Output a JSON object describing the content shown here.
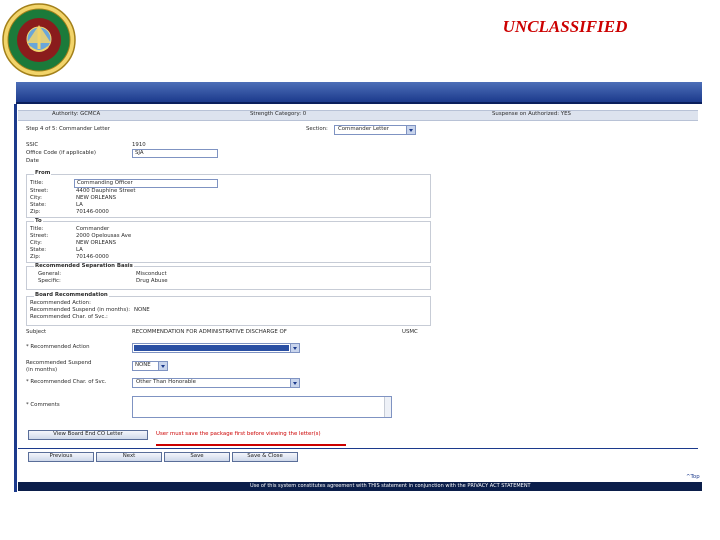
{
  "header": {
    "classification": "UNCLASSIFIED"
  },
  "seal": {
    "top_text": "U.S. MARINE CORPS",
    "bottom_text": "RESERVE"
  },
  "info_bar": {
    "authority": "Authority: GCMCA",
    "strength": "Strength Category: 0",
    "suspense": "Suspense on Authorized: YES"
  },
  "step": {
    "text": "Step 4 of 5: Commander Letter",
    "section_label": "Section:",
    "section_value": "Commander Letter"
  },
  "letter": {
    "ssic_label": "SSIC",
    "ssic_value": "1910",
    "office_label": "Office Code (if applicable)",
    "office_value": "SJA",
    "date_label": "Date"
  },
  "from": {
    "legend": "From",
    "title_label": "Title:",
    "title_value": "Commanding Officer",
    "street_label": "Street:",
    "street_value": "4400 Dauphine Street",
    "city_label": "City:",
    "city_value": "NEW ORLEANS",
    "state_label": "State:",
    "state_value": "LA",
    "zip_label": "Zip:",
    "zip_value": "70146-0000"
  },
  "to": {
    "legend": "To",
    "title_label": "Title:",
    "title_value": "Commander",
    "street_label": "Street:",
    "street_value": "2000 Opelousas Ave",
    "city_label": "City:",
    "city_value": "NEW ORLEANS",
    "state_label": "State:",
    "state_value": "LA",
    "zip_label": "Zip:",
    "zip_value": "70146-0000"
  },
  "separation": {
    "legend": "Recommended Separation Basis",
    "general_label": "General:",
    "general_value": "Misconduct",
    "specific_label": "Specific:",
    "specific_value": "Drug Abuse"
  },
  "board": {
    "legend": "Board Recommendation",
    "action_label": "Recommended Action:",
    "suspend_label": "Recommended Suspend (in months):",
    "suspend_value": "NONE",
    "char_label": "Recommended Char. of Svc.:"
  },
  "form": {
    "subject_label": "Subject",
    "subject_value": "RECOMMENDATION FOR ADMINISTRATIVE DISCHARGE OF",
    "subject_suffix": "USMC",
    "action_label": "* Recommended Action",
    "suspend_label": "Recommended Suspend",
    "suspend_sub": "(in months)",
    "suspend_value": "NONE",
    "char_label": "* Recommended Char. of Svc.",
    "char_value": "Other Than Honorable",
    "comments_label": "* Comments"
  },
  "actions": {
    "view_letter_button": "View Board End CO Letter",
    "warning": "User must save the package first before viewing the letter(s)",
    "previous": "Previous",
    "next": "Next",
    "save": "Save",
    "save_close": "Save & Close",
    "top_link": "^Top"
  },
  "footer": {
    "privacy": "Use of this system constitutes agreement with THIS statement in conjunction with the PRIVACY ACT STATEMENT"
  },
  "colors": {
    "classification": "#cc0000",
    "header_bar": "#1c3a8c",
    "warning": "#cc0000",
    "footer": "#0b1e4a"
  }
}
